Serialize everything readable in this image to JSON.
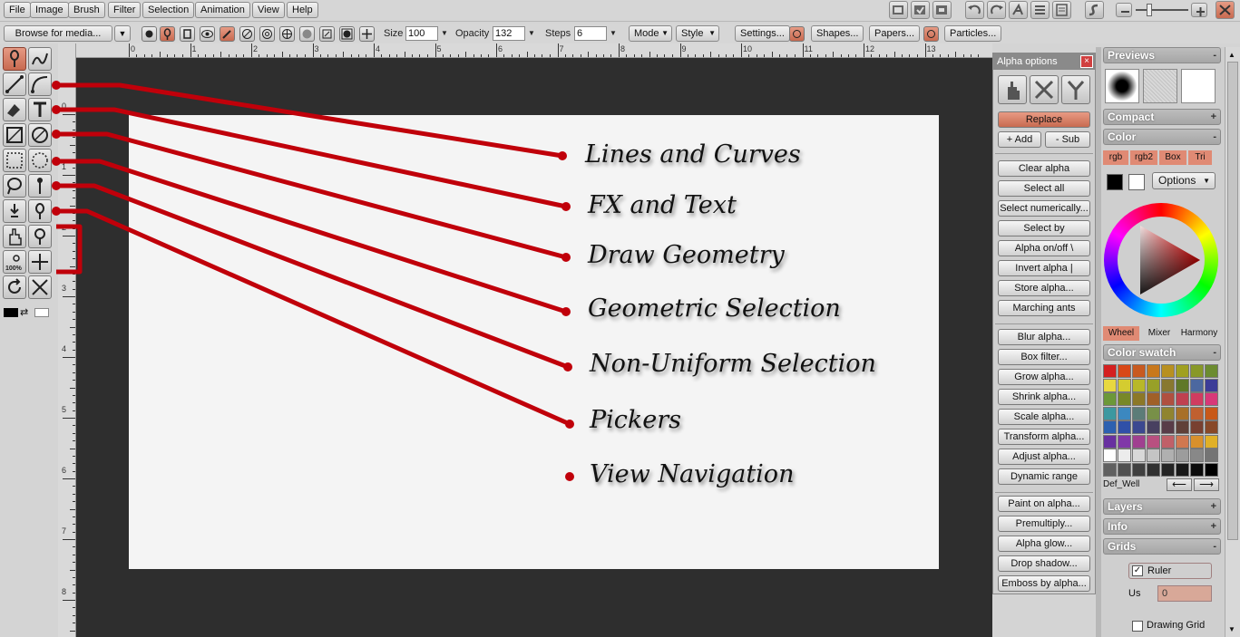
{
  "menu": [
    "File",
    "Image",
    "Brush",
    "Filter",
    "Selection",
    "Animation",
    "View",
    "Help"
  ],
  "toolbar": {
    "browse_label": "Browse for media...",
    "size_label": "Size",
    "size_value": "100",
    "opacity_label": "Opacity",
    "opacity_value": "132",
    "steps_label": "Steps",
    "steps_value": "6",
    "mode_label": "Mode",
    "style_label": "Style",
    "settings_label": "Settings...",
    "shapes_label": "Shapes...",
    "papers_label": "Papers...",
    "particles_label": "Particles..."
  },
  "ruler_top": [
    "0",
    "1",
    "2",
    "3",
    "4",
    "5",
    "6",
    "7",
    "8",
    "9",
    "10",
    "11",
    "12",
    "13",
    "14"
  ],
  "ruler_left": [
    "0",
    "1",
    "2",
    "3",
    "4",
    "5",
    "6",
    "7",
    "8"
  ],
  "annotations": [
    {
      "label": "Lines and Curves"
    },
    {
      "label": "FX and Text"
    },
    {
      "label": "Draw Geometry"
    },
    {
      "label": "Geometric Selection"
    },
    {
      "label": "Non-Uniform Selection"
    },
    {
      "label": "Pickers"
    },
    {
      "label": "View Navigation"
    }
  ],
  "tools": [
    "paint-brush-icon",
    "smudge-icon",
    "line-icon",
    "curve-icon",
    "fx-brush-icon",
    "text-icon",
    "rectangle-icon",
    "ellipse-icon",
    "rect-select-icon",
    "ellipse-select-icon",
    "lasso-icon",
    "magic-wand-icon",
    "pick-color-icon",
    "pick-brush-icon",
    "grab-icon",
    "picker-icon",
    "zoom-100-icon",
    "move-icon",
    "rotate-icon",
    "reset-icon"
  ],
  "alpha": {
    "title": "Alpha options",
    "close": "×",
    "replace": "Replace",
    "add": "+ Add",
    "sub": "- Sub",
    "buttons_group1": [
      "Clear alpha",
      "Select all",
      "Select numerically...",
      "Select by",
      "Alpha on/off  \\",
      "Invert alpha  |",
      "Store alpha...",
      "Marching ants"
    ],
    "buttons_group2": [
      "Blur alpha...",
      "Box filter...",
      "Grow alpha...",
      "Shrink alpha...",
      "Scale alpha...",
      "Transform alpha...",
      "Adjust alpha...",
      "Dynamic range"
    ],
    "buttons_group3": [
      "Paint on alpha...",
      "Premultiply...",
      "Alpha glow...",
      "Drop shadow...",
      "Emboss by alpha..."
    ]
  },
  "right": {
    "previews": "Previews",
    "compact": "Compact",
    "color": "Color",
    "color_tabs": [
      "rgb",
      "rgb2",
      "Box",
      "Tri"
    ],
    "options": "Options",
    "wheel_tabs": [
      "Wheel",
      "Mixer",
      "Harmony"
    ],
    "swatch": "Color swatch",
    "well_name": "Def_Well",
    "layers": "Layers",
    "info": "Info",
    "grids": "Grids",
    "ruler": "Ruler",
    "units_label": "Us",
    "units_value": "0",
    "drawing_grid": "Drawing Grid",
    "toggles": {
      "minus": "-",
      "plus": "+"
    }
  },
  "colors": {
    "accent": "#c86a50",
    "annotation_line": "#c0000a",
    "workspace": "#2e2e2e",
    "canvas": "#f4f4f4"
  },
  "swatches": [
    "#d42020",
    "#d84818",
    "#c85a20",
    "#c8781c",
    "#b89020",
    "#a0a020",
    "#889828",
    "#6c8c30",
    "#e8d840",
    "#d4cc30",
    "#b8b828",
    "#98a028",
    "#887830",
    "#607828",
    "#4c68a0",
    "#3c3c98",
    "#6c9838",
    "#788828",
    "#8c7828",
    "#a06028",
    "#b05040",
    "#c04050",
    "#d03c60",
    "#d83878",
    "#3c98a0",
    "#3c88c0",
    "#5c7c78",
    "#789048",
    "#908430",
    "#a87028",
    "#c06030",
    "#c85818",
    "#2c60b0",
    "#3050a8",
    "#3c4890",
    "#484060",
    "#583c48",
    "#604038",
    "#784030",
    "#884828",
    "#6830a0",
    "#8038a8",
    "#a04090",
    "#b85080",
    "#c06068",
    "#d07850",
    "#d8902c",
    "#e0b028",
    "#ffffff",
    "#ececec",
    "#d8d8d8",
    "#c4c4c4",
    "#b0b0b0",
    "#9c9c9c",
    "#888888",
    "#747474",
    "#606060",
    "#505050",
    "#404040",
    "#303030",
    "#242424",
    "#181818",
    "#0c0c0c",
    "#000000"
  ]
}
